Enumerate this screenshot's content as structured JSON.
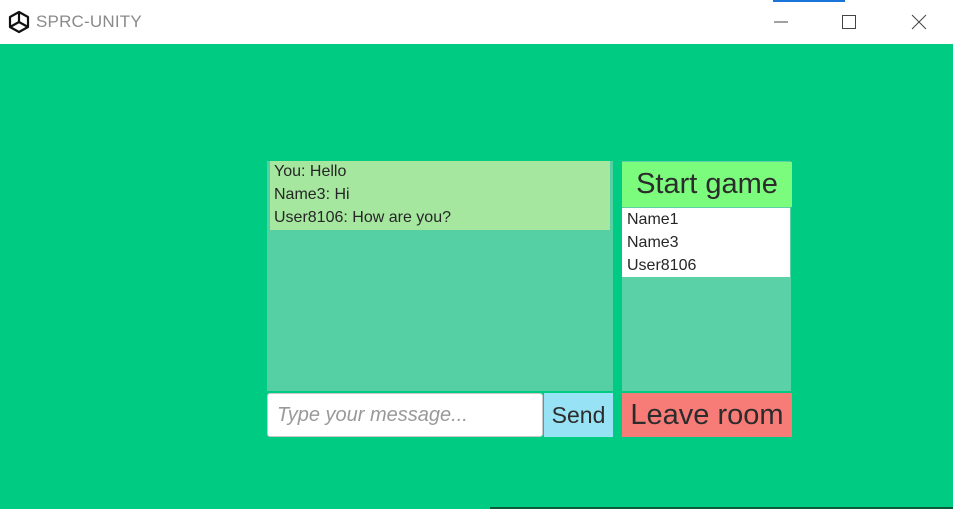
{
  "window": {
    "title": "SPRC-UNITY",
    "logo_icon": "unity-logo-icon",
    "controls": [
      "minimize-icon",
      "maximize-icon",
      "close-icon"
    ]
  },
  "chat": {
    "messages": [
      "You: Hello",
      "Name3: Hi",
      "User8106: How are you?"
    ],
    "input_placeholder": "Type your message...",
    "input_value": "",
    "send_label": "Send"
  },
  "room": {
    "start_label": "Start game",
    "players": [
      "Name1",
      "Name3",
      "User8106"
    ],
    "leave_label": "Leave room"
  },
  "colors": {
    "background": "#00cb83",
    "chat_panel": "#55d0a4",
    "message_highlight": "#a6e79f",
    "start_button": "#7cfc7c",
    "send_button": "#97e3f5",
    "leave_button": "#f77c78"
  }
}
